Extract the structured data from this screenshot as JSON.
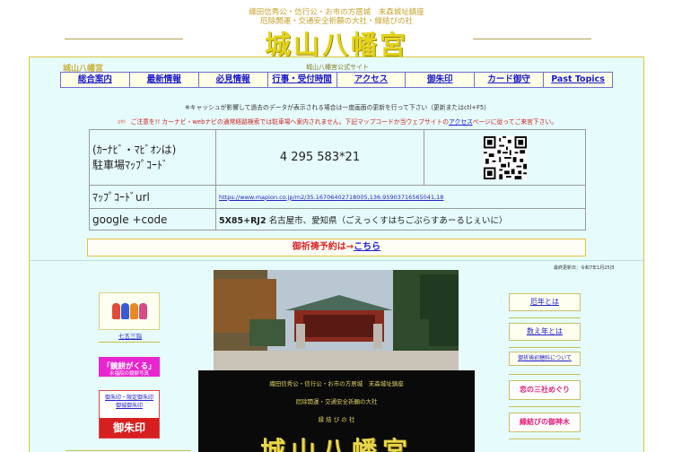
{
  "header": {
    "subtitle1": "織田信秀公・信行公・お市の方居城　末森城址鎮座",
    "subtitle2": "厄除開運・交通安全祈願の大社・縁結びの社",
    "title": "城山八幡宮"
  },
  "frame": {
    "logo": "城山八幡宮",
    "caption": "城山八幡宮公式サイト"
  },
  "nav": {
    "items": [
      "総合案内",
      "最新情報",
      "必見情報",
      "行事・受付時間",
      "アクセス",
      "御朱印",
      "カード御守",
      "Past Topics"
    ]
  },
  "notices": {
    "cache": "※キャッシュが影響して過去のデータが表示される場合は一度画面の更新を行って下さい（更新またはctl+F5）",
    "carnavi_pre": "ご注意を!! カーナビ・webナビの通常経路検索では駐車場へ案内されません。下記マップコードか当ウェブサイトの",
    "carnavi_link": "アクセス",
    "carnavi_post": "ページに従ってご来宮下さい。"
  },
  "table": {
    "row1_label1": "(ｶｰﾅﾋﾞ・ﾏﾋﾞｵﾝは)",
    "row1_label2": "駐車場ﾏｯﾌﾟｺｰﾄﾞ",
    "row1_code": "4 295 583*21",
    "row2_label": "ﾏｯﾌﾟｺｰﾄﾞurl",
    "row2_url": "https://www.mapion.co.jp/m2/35.16706402718005,136.95903716565041,18",
    "row3_label": "google +code",
    "row3_code": "5X85+RJ2",
    "row3_place": " 名古屋市、愛知県（ごえっくすはちごぷらすあーるじぇいに）"
  },
  "yoyaku": {
    "text": "御祈祷予約は→",
    "link": "こちら"
  },
  "updated": "最終更新日：令和7年1月25日",
  "banner": {
    "line1": "織田信秀公・信行公・お市の方居城　末森城址鎮座",
    "line2": "厄除開運・交通安全祈願の大社",
    "line3": "縁 結 び の 社",
    "title": "城山八幡宮"
  },
  "left": {
    "shichi_label": "七五三詣",
    "mirror_text": "「鏡餅がくる」",
    "mirror_caption": "永福院の鏡餅写真",
    "gosyuin_text1": "御朱印・限定御朱印",
    "gosyuin_text2": "御城御朱印",
    "gosyuin_red": "御朱印"
  },
  "right": {
    "btn1": "厄年とは",
    "btn2": "数え年とは",
    "btn3": "御祈祷初穂料について",
    "btn4": "恋の三社めぐり",
    "btn5": "縁結びの御神木"
  },
  "colors": {
    "accent_gold": "#e3d21c",
    "frame_bg": "#e6fbfb",
    "link_blue": "#1a1ad0",
    "red": "#d62828",
    "pink": "#e5207a"
  }
}
